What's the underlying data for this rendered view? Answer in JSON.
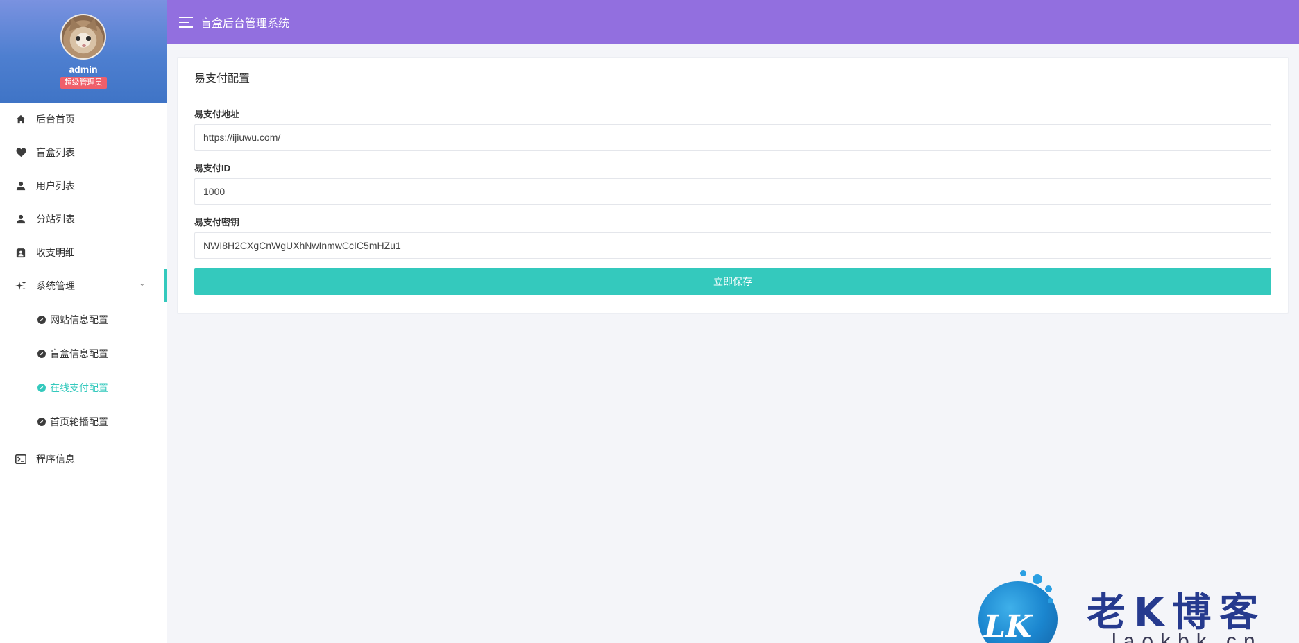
{
  "profile": {
    "name": "admin",
    "role": "超级管理员"
  },
  "sidebar": {
    "items": [
      {
        "label": "后台首页",
        "icon": "home-icon"
      },
      {
        "label": "盲盒列表",
        "icon": "heart-icon"
      },
      {
        "label": "用户列表",
        "icon": "user-icon"
      },
      {
        "label": "分站列表",
        "icon": "user-icon"
      },
      {
        "label": "收支明细",
        "icon": "contact-book-icon"
      },
      {
        "label": "系统管理",
        "icon": "sparkle-icon",
        "expanded": true
      },
      {
        "label": "程序信息",
        "icon": "terminal-icon"
      }
    ],
    "submenu": [
      {
        "label": "网站信息配置",
        "active": false
      },
      {
        "label": "盲盒信息配置",
        "active": false
      },
      {
        "label": "在线支付配置",
        "active": true
      },
      {
        "label": "首页轮播配置",
        "active": false
      }
    ]
  },
  "header": {
    "title": "盲盒后台管理系统"
  },
  "card": {
    "title": "易支付配置",
    "fields": [
      {
        "label": "易支付地址",
        "value": "https://ijiuwu.com/"
      },
      {
        "label": "易支付ID",
        "value": "1000"
      },
      {
        "label": "易支付密钥",
        "value": "NWI8H2CXgCnWgUXhNwInmwCcIC5mHZu1"
      }
    ],
    "save_label": "立即保存"
  },
  "watermark": {
    "logo_text": "LK",
    "title": "老K博客",
    "url": "laokbk.cn"
  },
  "colors": {
    "accent": "#34c9bd",
    "topbar": "#926fdf",
    "badge": "#ef5f6a"
  }
}
